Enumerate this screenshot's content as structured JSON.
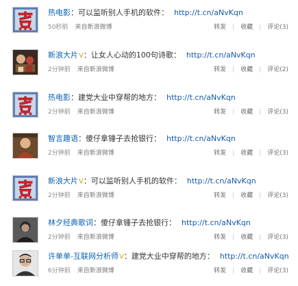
{
  "feed": {
    "items": [
      {
        "author": "热电影",
        "verified": false,
        "text": "可以监听别人手机的软件：",
        "link": "http://t.cn/aNvKqn",
        "time": "50秒前",
        "source": "来自新浪微博",
        "repost": "转发",
        "favorite": "收藏",
        "comment": "评论(3)",
        "avatar_icon": "hot-character-avatar"
      },
      {
        "author": "新浪大片",
        "verified": true,
        "text": "让女人心动的100句诗歌：",
        "link": "http://t.cn/aNvKqn",
        "time": "2分钟前",
        "source": "来自新浪微博",
        "repost": "转发",
        "favorite": "收藏",
        "comment": "评论(2)",
        "avatar_icon": "movie-poster-avatar"
      },
      {
        "author": "热电影",
        "verified": false,
        "text": "建党大业中穿帮的地方：",
        "link": "http://t.cn/aNvKqn",
        "time": "2分钟前",
        "source": "来自新浪微博",
        "repost": "转发",
        "favorite": "收藏",
        "comment": "评论(3)",
        "avatar_icon": "hot-character-avatar"
      },
      {
        "author": "智言趣语",
        "verified": false,
        "text": "傻仔拿锤子去抢银行：",
        "link": "http://t.cn/aNvKqn",
        "time": "2分钟前",
        "source": "来自新浪微博",
        "repost": "转发",
        "favorite": "收藏",
        "comment": "评论(3)",
        "avatar_icon": "painting-avatar"
      },
      {
        "author": "新浪大片",
        "verified": true,
        "text": "可以监听别人手机的软件：",
        "link": "http://t.cn/aNvKqn",
        "time": "2分钟前",
        "source": "来自新浪微博",
        "repost": "转发",
        "favorite": "收藏",
        "comment": "评论(3)",
        "avatar_icon": "movie-poster-avatar"
      },
      {
        "author": "林夕经典歌词",
        "verified": false,
        "text": "傻仔拿锤子去抢银行：",
        "link": "http://t.cn/aNvKqn",
        "time": "2分钟前",
        "source": "来自新浪微博",
        "repost": "转发",
        "favorite": "收藏",
        "comment": "评论(3)",
        "avatar_icon": "person-photo-avatar"
      },
      {
        "author": "许单单-互联网分析师",
        "verified": true,
        "text": "建党大业中穿帮的地方：",
        "link": "http://t.cn/aNvKqn",
        "time": "6分钟前",
        "source": "来自新浪微博",
        "repost": "转发",
        "favorite": "收藏",
        "comment": "评论(3)",
        "avatar_icon": "glasses-man-avatar"
      }
    ],
    "verified_mark": "V",
    "colors": {
      "author": "#0a62b3",
      "link": "#1458a8",
      "meta": "#8a8a8a",
      "verified": "#e59b00"
    }
  }
}
